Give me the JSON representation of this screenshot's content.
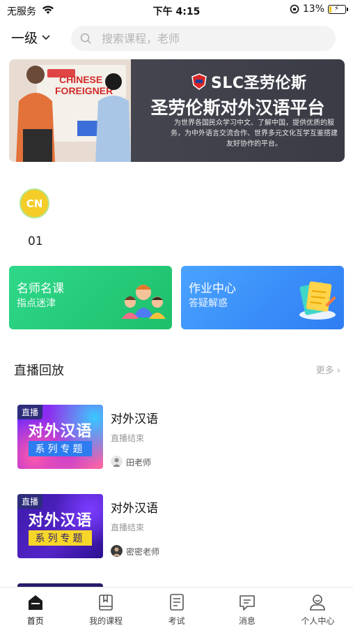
{
  "status_bar": {
    "carrier": "无服务",
    "time": "下午 4:15",
    "battery": "13%",
    "battery_level": 0.13
  },
  "header": {
    "level_label": "一级",
    "search_placeholder": "搜索课程，老师"
  },
  "banner": {
    "brand": "SLC圣劳伦斯",
    "title": "圣劳伦斯对外汉语平台",
    "description": "为世界各国民众学习中文、了解中国，提供优质的服务，为中外语言交流合作、世界多元文化互学互鉴搭建友好协作的平台。",
    "photo_sign_text": "CHINESE FOREIGNER"
  },
  "category": {
    "badge": "CN",
    "label": "01"
  },
  "feature_cards": [
    {
      "title": "名师名课",
      "subtitle": "指点迷津",
      "color": "#22cc7a"
    },
    {
      "title": "作业中心",
      "subtitle": "答疑解惑",
      "color": "#3a8ef6"
    }
  ],
  "live_section": {
    "title": "直播回放",
    "more": "更多"
  },
  "live_items": [
    {
      "tag": "直播",
      "thumb_title": "对外汉语",
      "thumb_sub": "系列专题",
      "name": "对外汉语",
      "status": "直播结束",
      "teacher": "田老师"
    },
    {
      "tag": "直播",
      "thumb_title": "对外汉语",
      "thumb_sub": "系列专题",
      "name": "对外汉语",
      "status": "直播结束",
      "teacher": "密密老师"
    }
  ],
  "tabs": [
    {
      "label": "首页",
      "icon": "home-icon",
      "active": true
    },
    {
      "label": "我的课程",
      "icon": "book-icon",
      "active": false
    },
    {
      "label": "考试",
      "icon": "exam-icon",
      "active": false
    },
    {
      "label": "消息",
      "icon": "message-icon",
      "active": false
    },
    {
      "label": "个人中心",
      "icon": "profile-icon",
      "active": false
    }
  ]
}
